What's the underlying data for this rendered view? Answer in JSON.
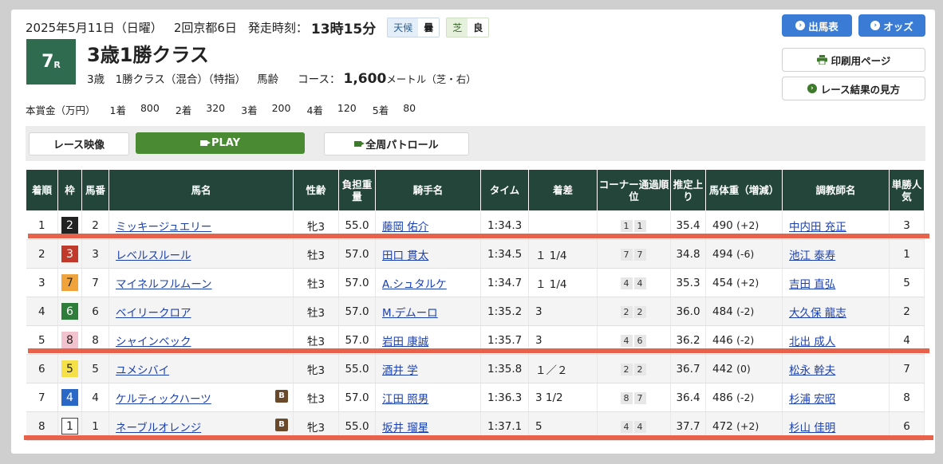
{
  "header": {
    "date": "2025年5月11日（日曜）",
    "meeting": "2回京都6日",
    "post_label": "発走時刻：",
    "post_time": "13時15分",
    "weather_label": "天候",
    "weather": "曇",
    "surface_label": "芝",
    "condition": "良",
    "race_no": "7",
    "race_suffix": "R",
    "race_name": "3歳1勝クラス",
    "sub_class": "3歳　1勝クラス（混合）（特指）",
    "sub_weight": "馬齢",
    "course_label": "コース：",
    "distance": "1,600",
    "distance_unit": "メートル（芝・右）"
  },
  "prize": {
    "label": "本賞金（万円）",
    "items": [
      {
        "place": "1着",
        "amount": "800"
      },
      {
        "place": "2着",
        "amount": "320"
      },
      {
        "place": "3着",
        "amount": "200"
      },
      {
        "place": "4着",
        "amount": "120"
      },
      {
        "place": "5着",
        "amount": "80"
      }
    ]
  },
  "buttons": {
    "entries": "出馬表",
    "odds": "オッズ",
    "print": "印刷用ページ",
    "howto": "レース結果の見方"
  },
  "video": {
    "label": "レース映像",
    "play": "PLAY",
    "patrol": "全周パトロール"
  },
  "columns": [
    "着順",
    "枠",
    "馬番",
    "馬名",
    "性齢",
    "負担重量",
    "騎手名",
    "タイム",
    "着差",
    "コーナー通過順位",
    "推定上り",
    "馬体重（増減）",
    "調教師名",
    "単勝人気"
  ],
  "rows": [
    {
      "place": "1",
      "frame": "2",
      "num": "2",
      "horse": "ミッキージュエリー",
      "blinker": "",
      "sexage": "牝3",
      "weight": "55.0",
      "jockey": "藤岡 佑介",
      "time": "1:34.3",
      "margin": "",
      "c1": "1",
      "c2": "1",
      "last3f": "35.4",
      "bw": "490",
      "bwd": "(+2)",
      "trainer": "中内田 充正",
      "pop": "3"
    },
    {
      "place": "2",
      "frame": "3",
      "num": "3",
      "horse": "レベルスルール",
      "blinker": "",
      "sexage": "牡3",
      "weight": "57.0",
      "jockey": "田口 貫太",
      "time": "1:34.5",
      "margin": "１ 1/4",
      "c1": "7",
      "c2": "7",
      "last3f": "34.8",
      "bw": "494",
      "bwd": "(-6)",
      "trainer": "池江 泰寿",
      "pop": "1"
    },
    {
      "place": "3",
      "frame": "7",
      "num": "7",
      "horse": "マイネルフルムーン",
      "blinker": "",
      "sexage": "牡3",
      "weight": "57.0",
      "jockey": "A.シュタルケ",
      "time": "1:34.7",
      "margin": "１ 1/4",
      "c1": "4",
      "c2": "4",
      "last3f": "35.3",
      "bw": "454",
      "bwd": "(+2)",
      "trainer": "吉田 直弘",
      "pop": "5"
    },
    {
      "place": "4",
      "frame": "6",
      "num": "6",
      "horse": "ベイリークロア",
      "blinker": "",
      "sexage": "牡3",
      "weight": "57.0",
      "jockey": "M.デムーロ",
      "time": "1:35.2",
      "margin": "3",
      "c1": "2",
      "c2": "2",
      "last3f": "36.0",
      "bw": "484",
      "bwd": "(-2)",
      "trainer": "大久保 龍志",
      "pop": "2"
    },
    {
      "place": "5",
      "frame": "8",
      "num": "8",
      "horse": "シャインベック",
      "blinker": "",
      "sexage": "牡3",
      "weight": "57.0",
      "jockey": "岩田 康誠",
      "time": "1:35.7",
      "margin": "3",
      "c1": "4",
      "c2": "6",
      "last3f": "36.2",
      "bw": "446",
      "bwd": "(-2)",
      "trainer": "北出 成人",
      "pop": "4"
    },
    {
      "place": "6",
      "frame": "5",
      "num": "5",
      "horse": "ユメシバイ",
      "blinker": "",
      "sexage": "牝3",
      "weight": "55.0",
      "jockey": "酒井 学",
      "time": "1:35.8",
      "margin": "１／２",
      "c1": "2",
      "c2": "2",
      "last3f": "36.7",
      "bw": "442",
      "bwd": "(0)",
      "trainer": "松永 幹夫",
      "pop": "7"
    },
    {
      "place": "7",
      "frame": "4",
      "num": "4",
      "horse": "ケルティックハーツ",
      "blinker": "B",
      "sexage": "牡3",
      "weight": "57.0",
      "jockey": "江田 照男",
      "time": "1:36.3",
      "margin": "3 1/2",
      "c1": "8",
      "c2": "7",
      "last3f": "36.4",
      "bw": "486",
      "bwd": "(-2)",
      "trainer": "杉浦 宏昭",
      "pop": "8"
    },
    {
      "place": "8",
      "frame": "1",
      "num": "1",
      "horse": "ネーブルオレンジ",
      "blinker": "B",
      "sexage": "牝3",
      "weight": "55.0",
      "jockey": "坂井 瑠星",
      "time": "1:37.1",
      "margin": "5",
      "c1": "4",
      "c2": "4",
      "last3f": "37.7",
      "bw": "472",
      "bwd": "(+2)",
      "trainer": "杉山 佳明",
      "pop": "6"
    }
  ],
  "colors": {
    "frame_bg": {
      "1": "#ffffff",
      "2": "#222222",
      "3": "#c0392b",
      "4": "#2a68c8",
      "5": "#f5e04a",
      "6": "#2e7d3a",
      "7": "#f0a33a",
      "8": "#f2c3cf"
    },
    "frame_fg": {
      "1": "#222222",
      "2": "#ffffff",
      "3": "#ffffff",
      "4": "#ffffff",
      "5": "#222222",
      "6": "#ffffff",
      "7": "#222222",
      "8": "#222222"
    },
    "header_bg": "#24463a",
    "annotation_line": "#e8624b"
  }
}
